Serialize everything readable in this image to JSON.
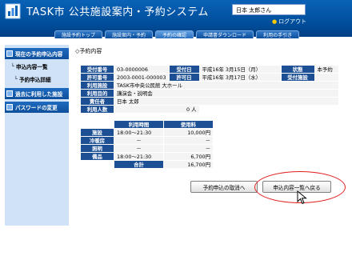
{
  "header": {
    "title": "TASK市 公共施設案内・予約システム",
    "user": "日本 太郎さん",
    "logout": "ログアウト"
  },
  "tabs": [
    {
      "label": "施設予約トップ"
    },
    {
      "label": "施設案内・予約"
    },
    {
      "label": "予約の確認"
    },
    {
      "label": "申請書ダウンロード"
    },
    {
      "label": "利用の手引き"
    }
  ],
  "sidebar": {
    "current": "現在の予約申込内容",
    "list": "申込内容一覧",
    "detail": "予約申込詳細",
    "past": "過去に利用した施設",
    "password": "パスワードの変更"
  },
  "section_label": "◇予約内容",
  "reservation": {
    "receipt_no_label": "受付番号",
    "receipt_no": "03-0000006",
    "receipt_date_label": "受付日",
    "receipt_date": "平成16年 3月15日（月）",
    "status_label": "状態",
    "status": "本予約",
    "permit_no_label": "許可番号",
    "permit_no": "2003-0001-000003",
    "permit_date_label": "許可日",
    "permit_date": "平成16年 3月17日（水）",
    "reception_facility_label": "受付施設",
    "reception_facility": "",
    "facility_label": "利用施設",
    "facility": "TASK市中央公民館  大ホール",
    "purpose_label": "利用目的",
    "purpose": "講演会・説明会",
    "responsible_label": "責任者",
    "responsible": "日本 太郎",
    "people_label": "利用人数",
    "people": "0 人"
  },
  "cost": {
    "header_time": "利用時間",
    "header_fee": "使用料",
    "rows": [
      {
        "label": "施設",
        "time": "18:00～21:30",
        "fee": "10,000円"
      },
      {
        "label": "冷暖房",
        "time": "－",
        "fee": "－"
      },
      {
        "label": "照明",
        "time": "－",
        "fee": "－"
      },
      {
        "label": "備品",
        "time": "18:00～21:30",
        "fee": "6,700円"
      }
    ],
    "total_label": "合計",
    "total": "16,700円"
  },
  "buttons": {
    "cancel": "予約申込の取消へ",
    "back": "申込内容一覧へ戻る"
  },
  "colors": {
    "header_blue": "#004f9c",
    "label_blue": "#1d4f94",
    "sidebar_bg": "#cfe2f7",
    "highlight_red": "#e21c1c"
  }
}
